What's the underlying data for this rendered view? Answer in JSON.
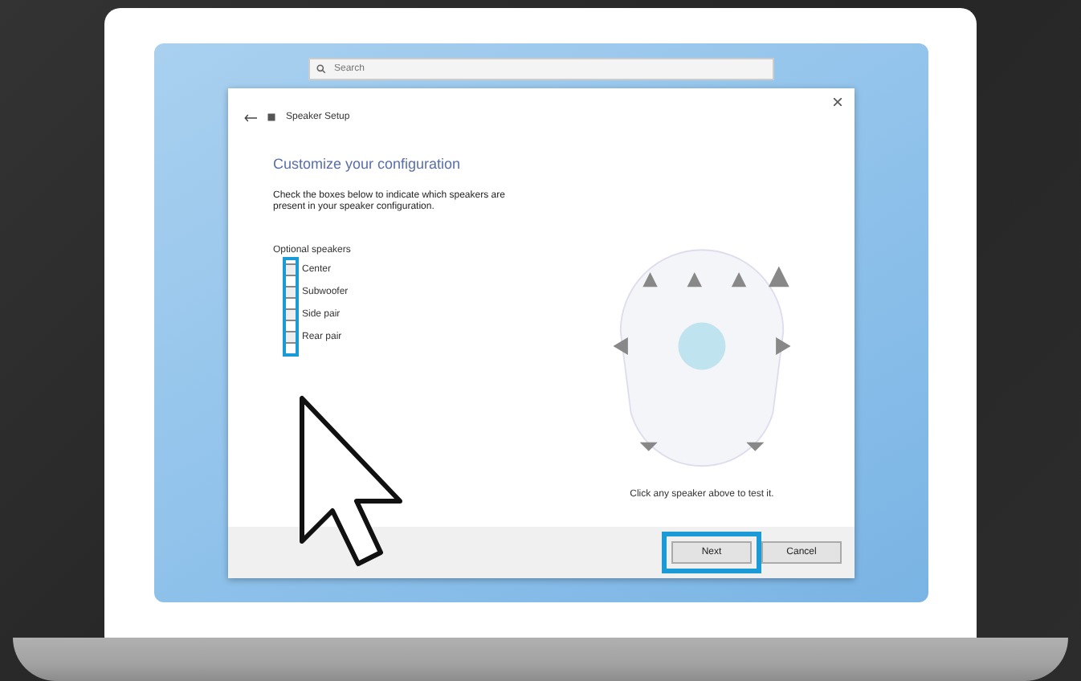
{
  "search": {
    "placeholder": "Search"
  },
  "dialog": {
    "title": "Speaker Setup",
    "heading": "Customize your configuration",
    "instructions": "Check the boxes below to indicate which speakers are present in your speaker configuration.",
    "group_label": "Optional speakers",
    "checkboxes_highlighted": true,
    "speakers": [
      {
        "label": "Center",
        "checked": false
      },
      {
        "label": "Subwoofer",
        "checked": false
      },
      {
        "label": "Side pair",
        "checked": false
      },
      {
        "label": "Rear pair",
        "checked": false
      }
    ],
    "test_hint": "Click any speaker above to test it.",
    "buttons": [
      {
        "label": "Next",
        "highlighted": true
      },
      {
        "label": "Cancel",
        "highlighted": false
      }
    ]
  }
}
